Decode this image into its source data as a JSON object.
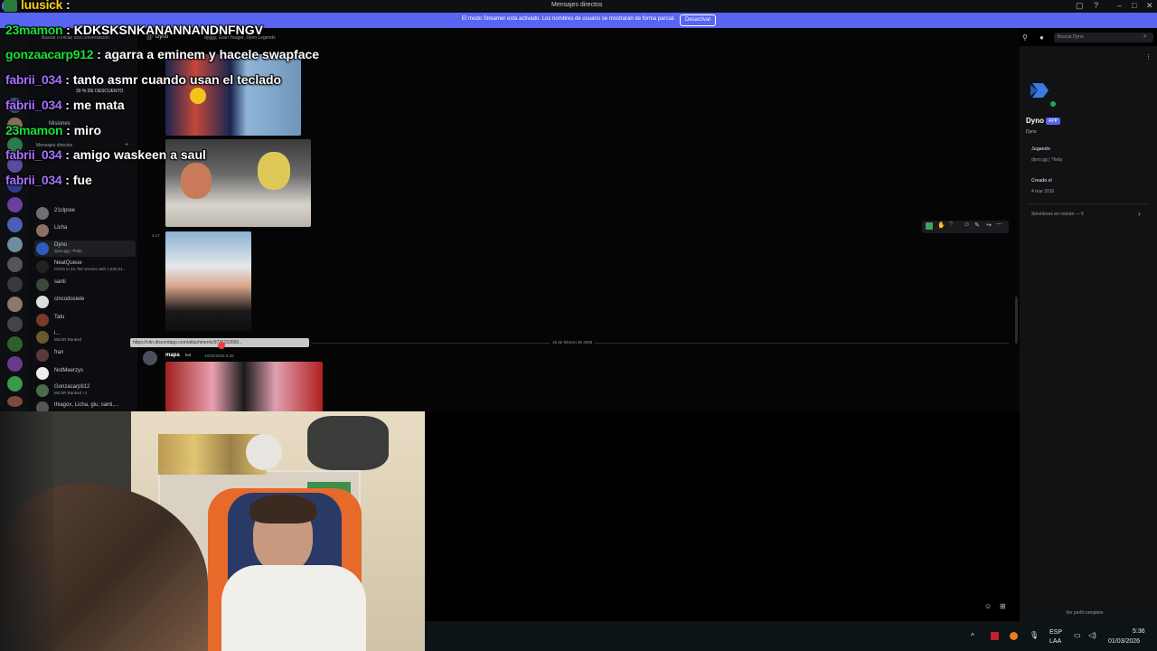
{
  "window": {
    "title": "Mensajes directos"
  },
  "banner": {
    "text": "El modo Streamer está activado. Los nombres de usuario se mostrarán de forma parcial.",
    "button": "Desactivar"
  },
  "dm_header": {
    "search_placeholder": "Buscar o iniciar una conversación",
    "channel": "Dyno",
    "mutuals": "dyggy, Gran Yeager, Dyno Legends"
  },
  "top_right": {
    "search_placeholder": "Buscar Dyno"
  },
  "dm_list": {
    "promo": "30 % DE DESCUENTO",
    "missions": "Misiones",
    "section": "Mensajes directos",
    "items": [
      {
        "name": "21clpree",
        "sub": ""
      },
      {
        "name": "Licha",
        "sub": ""
      },
      {
        "name": "Dyno",
        "sub": "dyno.gg | ?help"
      },
      {
        "name": "NeatQueue",
        "sub": "PUGs in 22,759 servers with 1,530,21..."
      },
      {
        "name": "santi",
        "sub": ""
      },
      {
        "name": "cincodosiete",
        "sub": ""
      },
      {
        "name": "Tatu",
        "sub": ""
      },
      {
        "name": "i...",
        "sub": "MCSR Ranked"
      },
      {
        "name": "fran",
        "sub": ""
      },
      {
        "name": "NotMeerzys",
        "sub": ""
      },
      {
        "name": "Gonzacarp912",
        "sub": "MCSR Ranked +1"
      },
      {
        "name": "thiagox, Licha, giu, santi,...",
        "sub": ""
      }
    ]
  },
  "chat": {
    "time_left": "4:17",
    "link_tooltip": "https://cdn.discordapp.com/attachments/9731153560...",
    "date_divider": "16 de febrero de 2026",
    "message": {
      "author": "mapa",
      "tag": "bot",
      "time": "16/02/2026 0:28"
    }
  },
  "profile": {
    "name": "Dyno",
    "badge": "APP",
    "sub": "Dyno",
    "playing_label": "Jugando",
    "playing_value": "dyno.gg | ?help",
    "created_label": "Creado el",
    "created_value": "4 mar 2016",
    "servers_common": "Servidores en común — 6",
    "full_profile": "Ver perfil completo"
  },
  "overlay_chat": [
    {
      "user": "luusick",
      "msg": "",
      "color": "#ffd11a"
    },
    {
      "user": "23mamon",
      "msg": "KDKSKSNKANANNANDNFNGV",
      "color": "#19e03a"
    },
    {
      "user": "gonzaacarp912",
      "msg": "agarra a eminem y hacele swapface",
      "color": "#19e03a"
    },
    {
      "user": "fabrii_034",
      "msg": "tanto asmr cuando usan el teclado",
      "color": "#a970ff"
    },
    {
      "user": "fabrii_034",
      "msg": "me mata",
      "color": "#a970ff"
    },
    {
      "user": "23mamon",
      "msg": "miro",
      "color": "#19e03a"
    },
    {
      "user": "fabrii_034",
      "msg": "amigo waskeen a saul",
      "color": "#a970ff"
    },
    {
      "user": "fabrii_034",
      "msg": "fue",
      "color": "#a970ff"
    }
  ],
  "taskbar": {
    "lang": "ESP",
    "layout": "LAA",
    "time": "5:36",
    "date": "01/03/2026"
  },
  "colors": {
    "blurple": "#5865f2",
    "panel": "#111214",
    "bg": "#000000"
  }
}
